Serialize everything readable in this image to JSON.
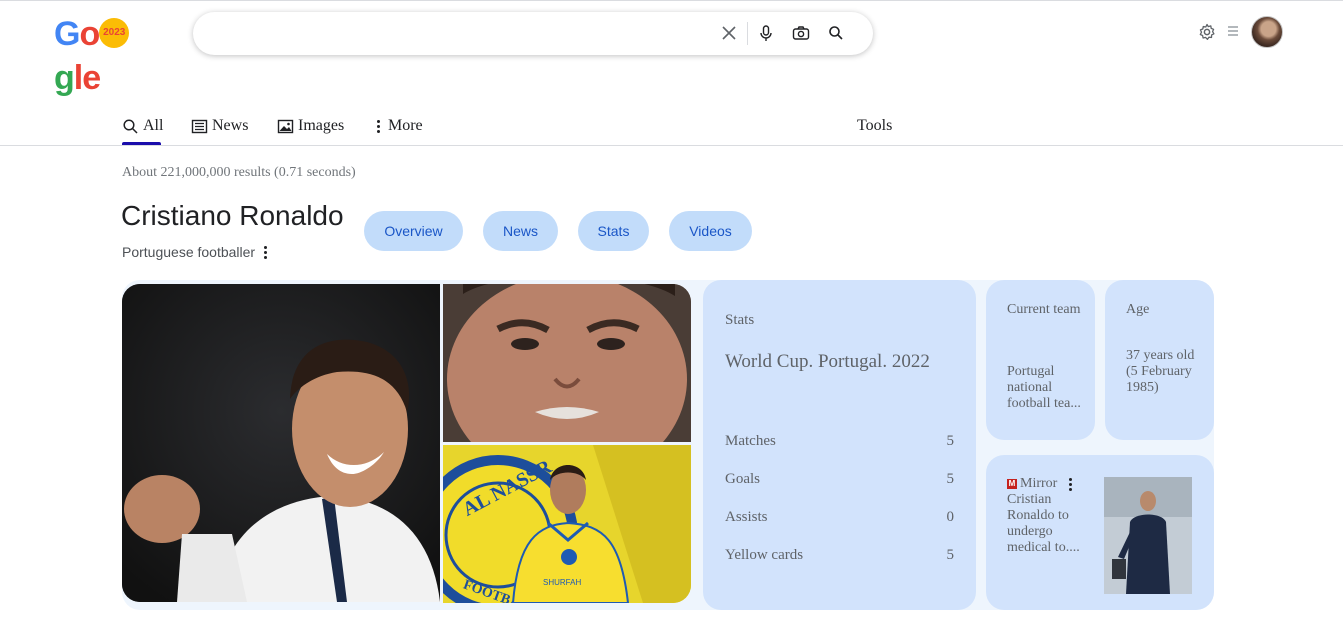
{
  "logo": {
    "g": "G",
    "o1": "o",
    "ball": "2023",
    "rest_l": "g",
    "rest_e": "le"
  },
  "search": {
    "value": "",
    "placeholder": ""
  },
  "tabs": [
    {
      "label": "All"
    },
    {
      "label": "News"
    },
    {
      "label": "Images"
    },
    {
      "label": "More"
    }
  ],
  "tools_label": "Tools",
  "result_stats": "About 221,000,000 results (0.71 seconds)",
  "entity": {
    "title": "Cristiano Ronaldo",
    "subtitle": "Portuguese footballer",
    "chips": [
      "Overview",
      "News",
      "Stats",
      "Videos"
    ]
  },
  "stats_card": {
    "label": "Stats",
    "title": "World Cup. Portugal. 2022",
    "rows": [
      {
        "name": "Matches",
        "value": "5"
      },
      {
        "name": "Goals",
        "value": "5"
      },
      {
        "name": "Assists",
        "value": "0"
      },
      {
        "name": "Yellow cards",
        "value": "5"
      }
    ]
  },
  "team_card": {
    "label": "Current team",
    "value": "Portugal national football tea..."
  },
  "age_card": {
    "label": "Age",
    "value": "37 years old (5 February 1985)"
  },
  "news_card": {
    "logo_letter": "M",
    "source": "Mirror",
    "headline": "Cristian Ronaldo to undergo medical to...."
  },
  "photo_text": {
    "club_crest": "AL NASSR",
    "club_crest_bottom": "FOOTBALL",
    "sponsor": "SHURFAH"
  },
  "colors": {
    "accent": "#1a0dab",
    "chip_bg": "#c2dcfa",
    "chip_text": "#1a56c7",
    "card_bg": "#d2e3fc"
  }
}
